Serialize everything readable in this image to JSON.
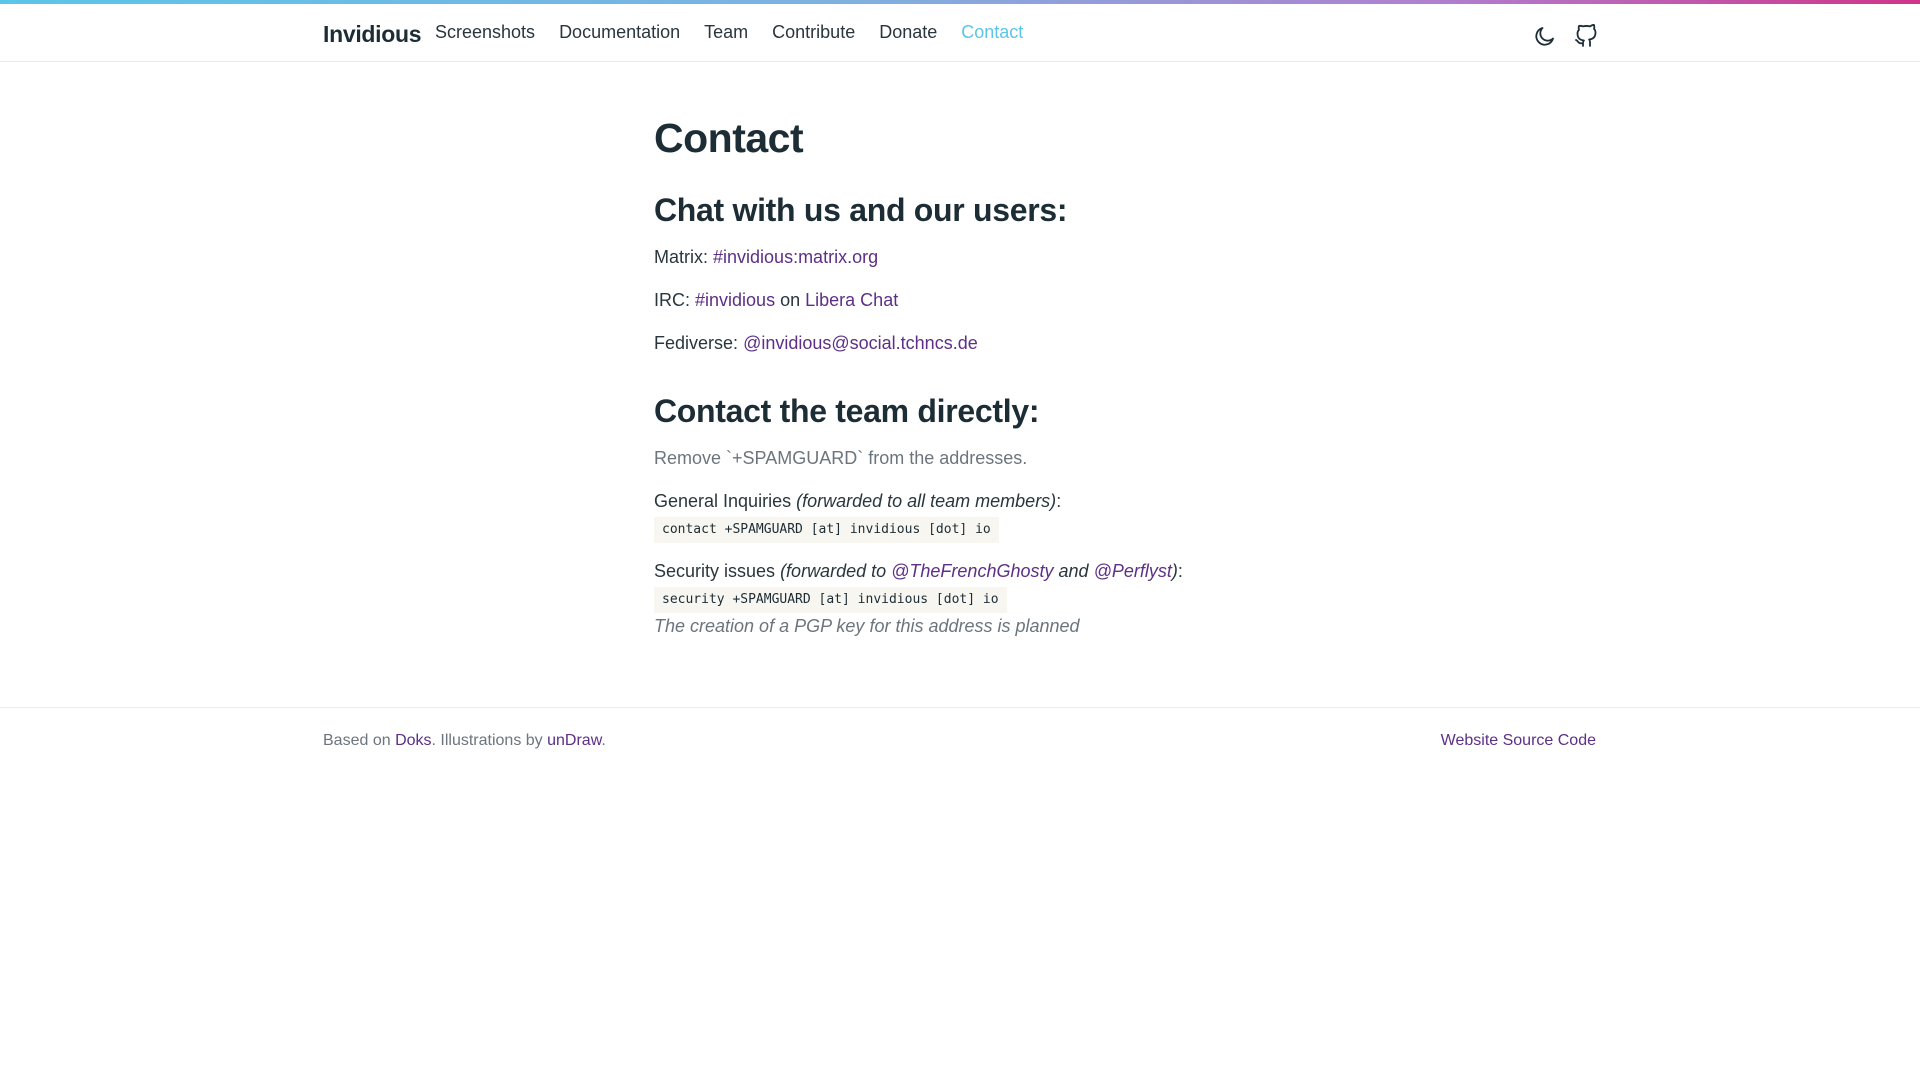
{
  "header": {
    "brand": "Invidious",
    "nav": [
      {
        "label": "Screenshots"
      },
      {
        "label": "Documentation"
      },
      {
        "label": "Team"
      },
      {
        "label": "Contribute"
      },
      {
        "label": "Donate"
      },
      {
        "label": "Contact",
        "active": true
      }
    ],
    "icons": [
      "moon-icon",
      "github-icon"
    ]
  },
  "page": {
    "title": "Contact",
    "chat_heading": "Chat with us and our users:",
    "matrix_label": "Matrix:",
    "matrix_link": "#invidious:matrix.org",
    "irc_label": "IRC:",
    "irc_link": "#invidious",
    "irc_on": "on",
    "irc_network": "Libera Chat",
    "fediverse_label": "Fediverse:",
    "fediverse_link": "@invidious@social.tchncs.de",
    "team_heading": "Contact the team directly:",
    "spamguard_note": "Remove `+SPAMGUARD` from the addresses.",
    "general_label": "General Inquiries",
    "general_note": "(forwarded to all team members)",
    "general_colon": ":",
    "general_address": "contact +SPAMGUARD [at] invidious [dot] io",
    "security_label": "Security issues",
    "security_note_pre": "(forwarded to",
    "security_person1": "@TheFrenchGhosty",
    "security_and": "and",
    "security_person2": "@Perflyst",
    "security_note_post": ")",
    "security_colon": ":",
    "security_address": "security +SPAMGUARD [at] invidious [dot] io",
    "pgp_note": "The creation of a PGP key for this address is planned"
  },
  "footer": {
    "based_on": "Based on",
    "doks": "Doks",
    "illustrations": ". Illustrations by",
    "undraw": "unDraw",
    "period": ".",
    "source": "Website Source Code"
  },
  "colors": {
    "active_nav": "#5bc5e9",
    "link": "#5d2f86",
    "text": "#1d2d35",
    "muted": "#6c757d"
  }
}
